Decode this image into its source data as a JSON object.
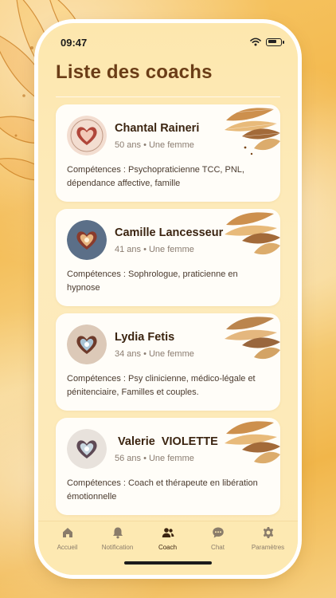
{
  "status": {
    "time": "09:47"
  },
  "header": {
    "title": "Liste des coachs"
  },
  "coaches": [
    {
      "name": "Chantal Raineri",
      "meta": "50 ans • Une femme",
      "skills": "Compétences : Psychopraticienne TCC, PNL, dépendance affective, famille"
    },
    {
      "name": "Camille Lancesseur",
      "meta": "41 ans • Une femme",
      "skills": "Compétences : Sophrologue, praticienne en hypnose"
    },
    {
      "name": "Lydia Fetis",
      "meta": "34 ans • Une femme",
      "skills": "Compétences : Psy clinicienne, médico-légale et pénitenciaire, Familles et couples."
    },
    {
      "name": " Valerie  VIOLETTE",
      "meta": "56 ans • Une femme",
      "skills": "Compétences : Coach et thérapeute en libération émotionnelle"
    }
  ],
  "tabbar": {
    "items": [
      {
        "label": "Accueil",
        "icon": "home-icon"
      },
      {
        "label": "Notification",
        "icon": "bell-icon"
      },
      {
        "label": "Coach",
        "icon": "users-icon",
        "active": true
      },
      {
        "label": "Chat",
        "icon": "chat-bubble-icon"
      },
      {
        "label": "Paramètres",
        "icon": "gear-icon"
      }
    ]
  },
  "colors": {
    "title": "#6b3d17",
    "accent_bg": "#fde9b2",
    "card_bg": "#fffdf8"
  }
}
